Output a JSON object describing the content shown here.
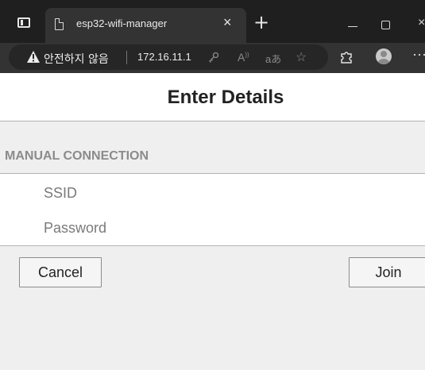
{
  "browser": {
    "tab": {
      "title": "esp32-wifi-manager",
      "close_glyph": "×",
      "favicon": "page-icon"
    },
    "new_tab_glyph": "+",
    "window_controls": {
      "minimize": "—",
      "maximize": "□",
      "close": "×"
    },
    "address_bar": {
      "security_warning": "안전하지 않음",
      "url": "172.16.11.1",
      "icons": [
        "key-icon",
        "read-aloud-icon",
        "translate-icon",
        "add-favorite-icon"
      ]
    },
    "toolbar_icons": [
      "extensions-icon",
      "profile-icon",
      "more-icon"
    ],
    "colors": {
      "chrome_dark": "#1f1f1f",
      "chrome_mid": "#333333",
      "address_bg": "#262626"
    }
  },
  "page": {
    "title": "Enter Details",
    "section_label": "MANUAL CONNECTION",
    "ssid": {
      "value": "",
      "placeholder": "SSID"
    },
    "password": {
      "value": "",
      "placeholder": "Password"
    },
    "buttons": {
      "cancel": "Cancel",
      "join": "Join"
    },
    "colors": {
      "background": "#efefef",
      "card": "#ffffff",
      "divider": "#b3b3b3",
      "section_label": "#8b8b8b"
    }
  }
}
